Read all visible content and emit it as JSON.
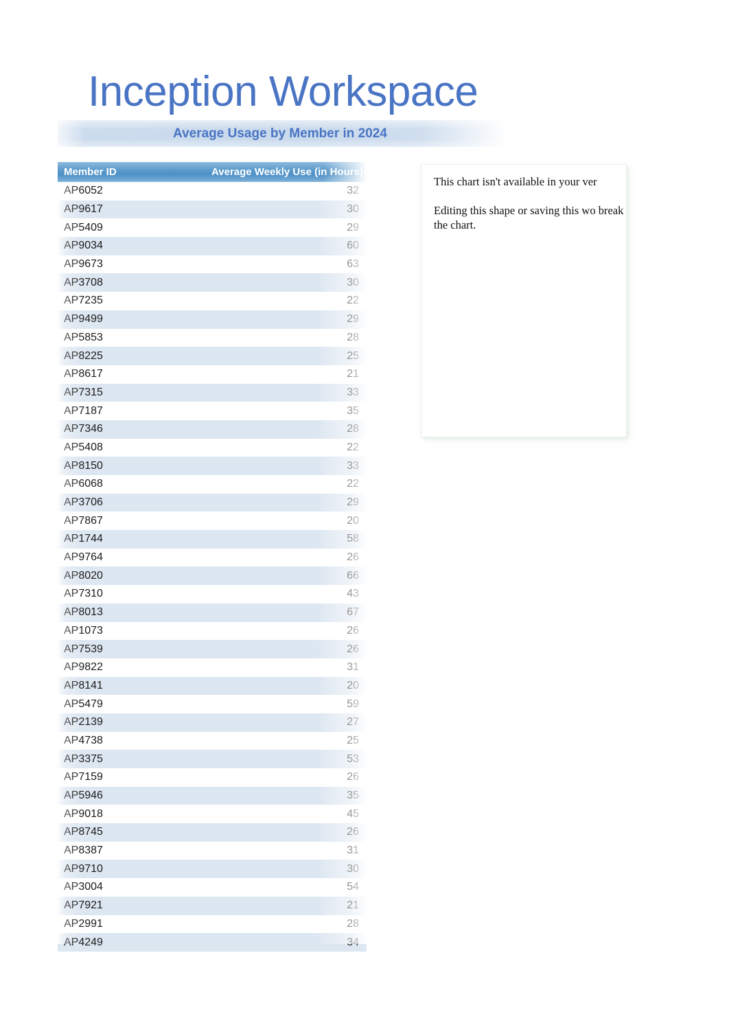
{
  "document": {
    "title": "Inception Workspace",
    "subtitle": "Average Usage by Member in 2024"
  },
  "table": {
    "headers": {
      "member_id": "Member ID",
      "weekly_use": "Average Weekly Use (in Hours)"
    },
    "rows": [
      {
        "member_id": "AP6052",
        "hours": 32
      },
      {
        "member_id": "AP9617",
        "hours": 30
      },
      {
        "member_id": "AP5409",
        "hours": 29
      },
      {
        "member_id": "AP9034",
        "hours": 60
      },
      {
        "member_id": "AP9673",
        "hours": 63
      },
      {
        "member_id": "AP3708",
        "hours": 30
      },
      {
        "member_id": "AP7235",
        "hours": 22
      },
      {
        "member_id": "AP9499",
        "hours": 29
      },
      {
        "member_id": "AP5853",
        "hours": 28
      },
      {
        "member_id": "AP8225",
        "hours": 25
      },
      {
        "member_id": "AP8617",
        "hours": 21
      },
      {
        "member_id": "AP7315",
        "hours": 33
      },
      {
        "member_id": "AP7187",
        "hours": 35
      },
      {
        "member_id": "AP7346",
        "hours": 28
      },
      {
        "member_id": "AP5408",
        "hours": 22
      },
      {
        "member_id": "AP8150",
        "hours": 33
      },
      {
        "member_id": "AP6068",
        "hours": 22
      },
      {
        "member_id": "AP3706",
        "hours": 29
      },
      {
        "member_id": "AP7867",
        "hours": 20
      },
      {
        "member_id": "AP1744",
        "hours": 58
      },
      {
        "member_id": "AP9764",
        "hours": 26
      },
      {
        "member_id": "AP8020",
        "hours": 66
      },
      {
        "member_id": "AP7310",
        "hours": 43
      },
      {
        "member_id": "AP8013",
        "hours": 67
      },
      {
        "member_id": "AP1073",
        "hours": 26
      },
      {
        "member_id": "AP7539",
        "hours": 26
      },
      {
        "member_id": "AP9822",
        "hours": 31
      },
      {
        "member_id": "AP8141",
        "hours": 20
      },
      {
        "member_id": "AP5479",
        "hours": 59
      },
      {
        "member_id": "AP2139",
        "hours": 27
      },
      {
        "member_id": "AP4738",
        "hours": 25
      },
      {
        "member_id": "AP3375",
        "hours": 53
      },
      {
        "member_id": "AP7159",
        "hours": 26
      },
      {
        "member_id": "AP5946",
        "hours": 35
      },
      {
        "member_id": "AP9018",
        "hours": 45
      },
      {
        "member_id": "AP8745",
        "hours": 26
      },
      {
        "member_id": "AP8387",
        "hours": 31
      },
      {
        "member_id": "AP9710",
        "hours": 30
      },
      {
        "member_id": "AP3004",
        "hours": 54
      },
      {
        "member_id": "AP7921",
        "hours": 21
      },
      {
        "member_id": "AP2991",
        "hours": 28
      },
      {
        "member_id": "AP4249",
        "hours": 34
      }
    ]
  },
  "chart_placeholder": {
    "line1": "This chart isn't available in your ver",
    "line2": "Editing this shape or saving this wo break the chart."
  },
  "colors": {
    "title_blue": "#4A74C4",
    "header_blue": "#5e9ccc",
    "row_stripe": "#dde7f1",
    "banner_blue": "#c4d6ea"
  }
}
